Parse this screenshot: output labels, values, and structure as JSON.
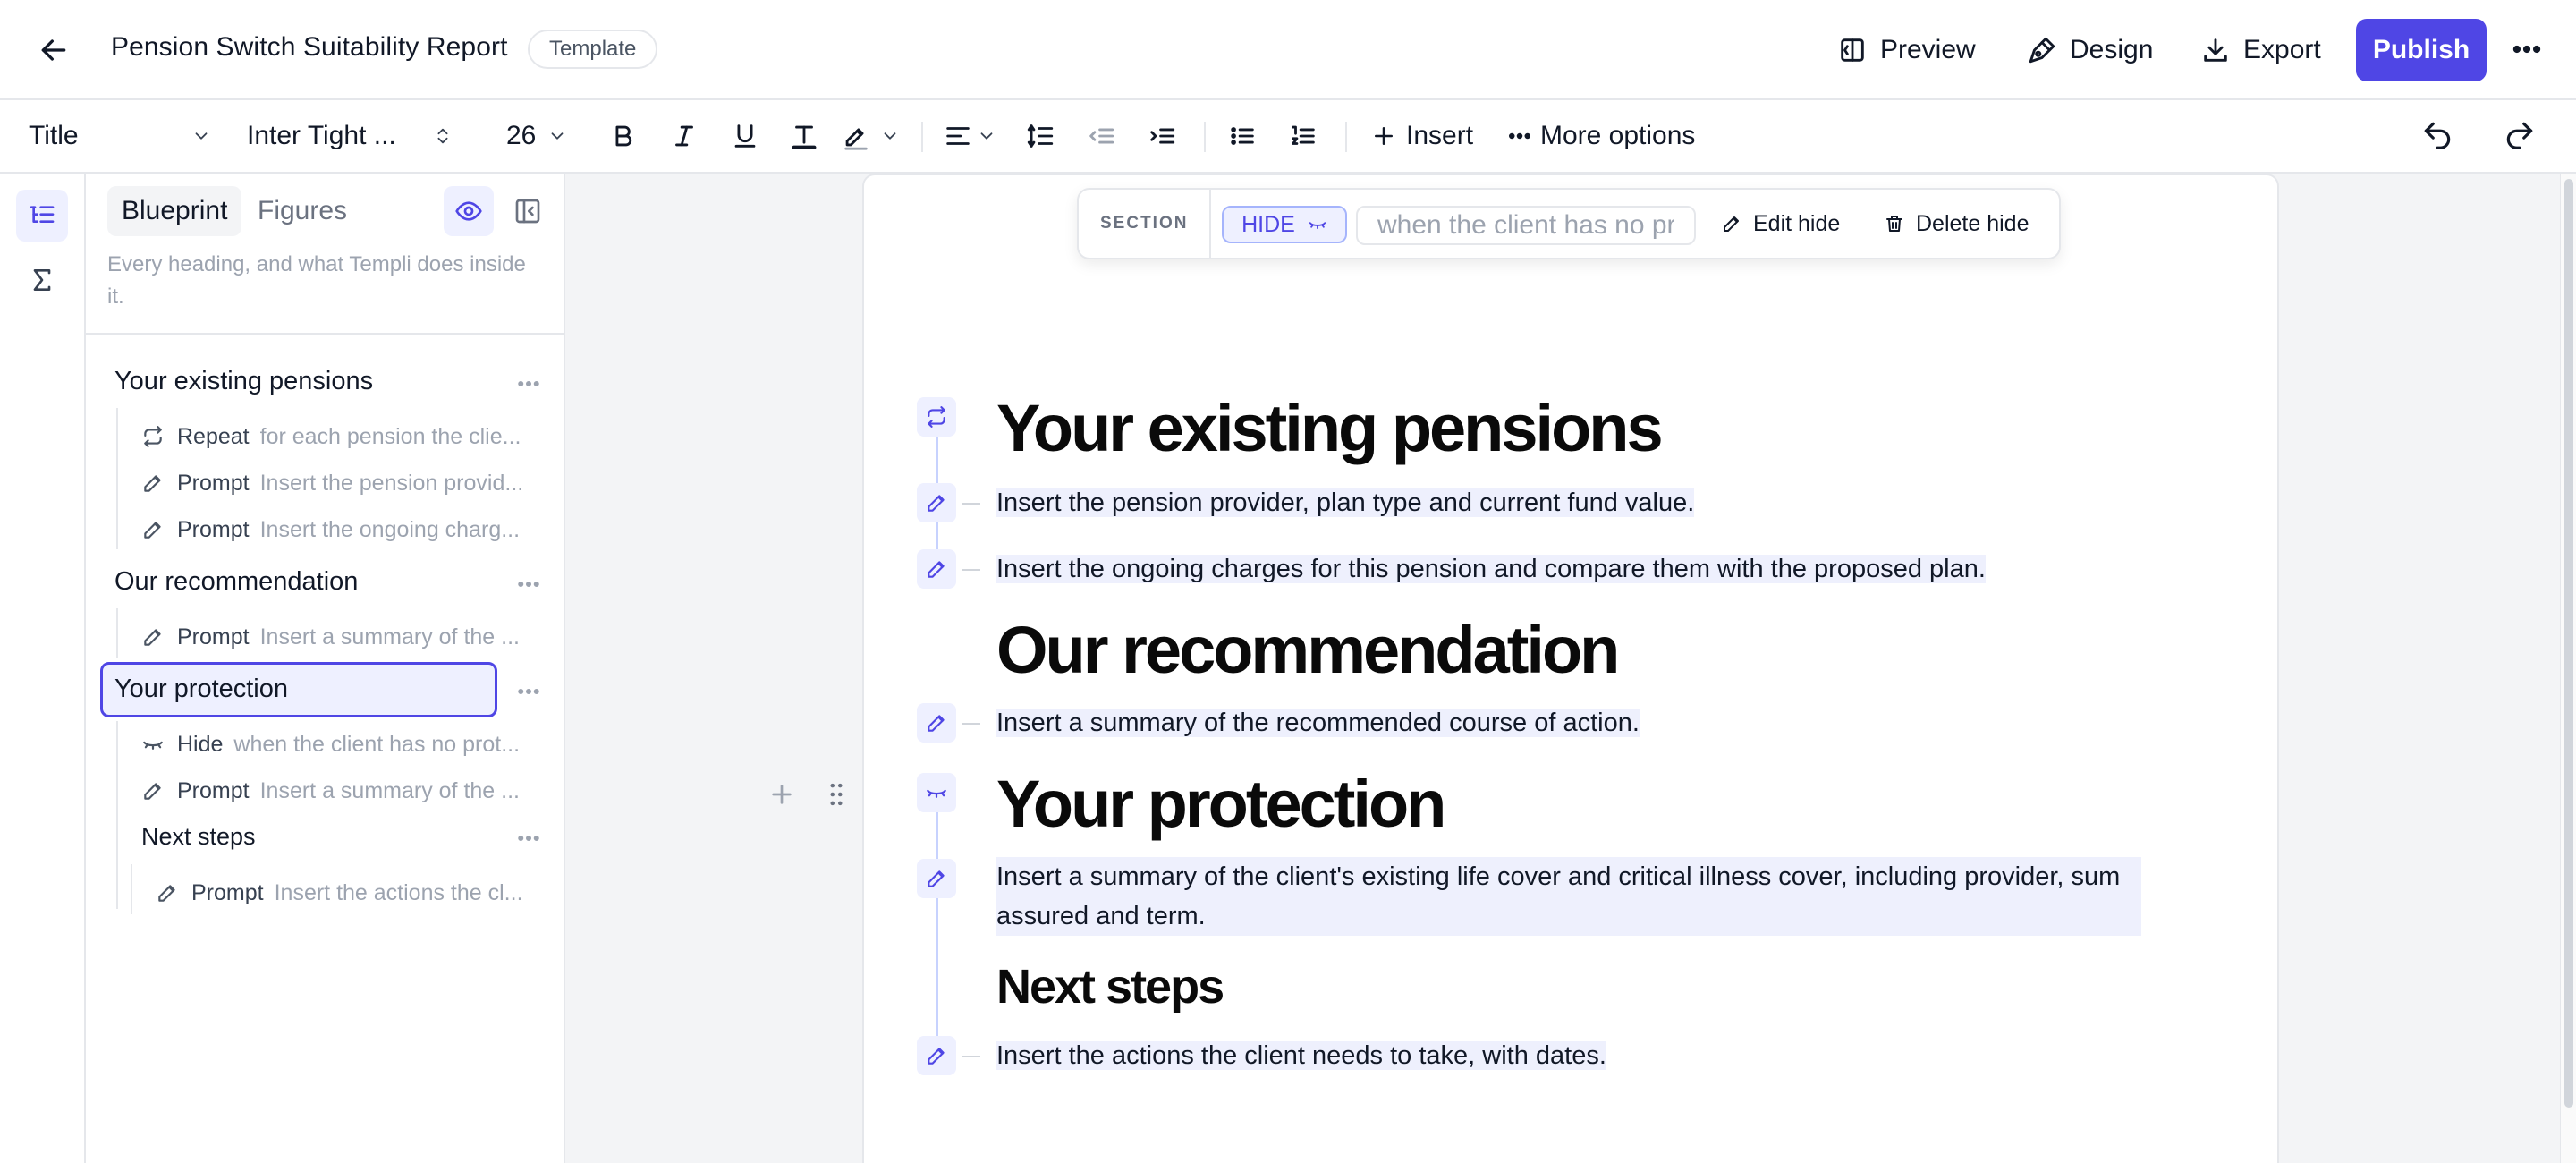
{
  "header": {
    "doc_title": "Pension Switch Suitability Report",
    "template_badge": "Template",
    "preview_label": "Preview",
    "design_label": "Design",
    "export_label": "Export",
    "publish_label": "Publish"
  },
  "toolbar": {
    "block_type": "Title",
    "font_family": "Inter Tight ...",
    "font_size": "26",
    "insert_label": "Insert",
    "more_options_label": "More options"
  },
  "panel": {
    "tabs": [
      "Blueprint",
      "Figures"
    ],
    "description": "Every heading, and what Templi does inside it.",
    "outline": {
      "section1": {
        "heading": "Your existing pensions",
        "rows": [
          {
            "kind": "Repeat",
            "text": "for each pension the clie..."
          },
          {
            "kind": "Prompt",
            "text": "Insert the pension provid..."
          },
          {
            "kind": "Prompt",
            "text": "Insert the ongoing charg..."
          }
        ]
      },
      "section2": {
        "heading": "Our recommendation",
        "rows": [
          {
            "kind": "Prompt",
            "text": "Insert a summary of the ..."
          }
        ]
      },
      "section3": {
        "heading": "Your protection",
        "rows": [
          {
            "kind": "Hide",
            "text": "when the client has no prot..."
          },
          {
            "kind": "Prompt",
            "text": "Insert a summary of the ..."
          }
        ],
        "sub_heading": "Next steps",
        "sub_rows": [
          {
            "kind": "Prompt",
            "text": "Insert the actions the cl..."
          }
        ]
      }
    }
  },
  "section_bar": {
    "label": "SECTION",
    "rule_kind": "HIDE",
    "condition_value": "when the client has no pr",
    "edit_label": "Edit hide",
    "delete_label": "Delete hide"
  },
  "document": {
    "h1_existing": "Your existing pensions",
    "p_existing_1": "Insert the pension provider, plan type and current fund value.",
    "p_existing_2": "Insert the ongoing charges for this pension and compare them with the proposed plan.",
    "h1_recommendation": "Our recommendation",
    "p_recommendation": "Insert a summary of the recommended course of action.",
    "h1_protection": "Your protection",
    "p_protection_line1": "Insert a summary of the client's existing life cover and critical illness cover, including provider, sum",
    "p_protection_line2": "assured and term.",
    "h2_next_steps": "Next steps",
    "p_next_steps": "Insert the actions the client needs to take, with dates."
  },
  "colors": {
    "accent": "#4f46e5",
    "accent_soft": "#eef0ff",
    "prompt_highlight": "#eef0fd",
    "canvas_bg": "#f3f4f6"
  },
  "icons": {
    "back": "arrow-left-icon",
    "preview": "preview-icon",
    "design": "pen-tool-icon",
    "export": "download-icon",
    "more": "more-horizontal-icon",
    "repeat": "repeat-icon",
    "prompt": "pencil-icon",
    "hide": "eye-closed-icon"
  }
}
